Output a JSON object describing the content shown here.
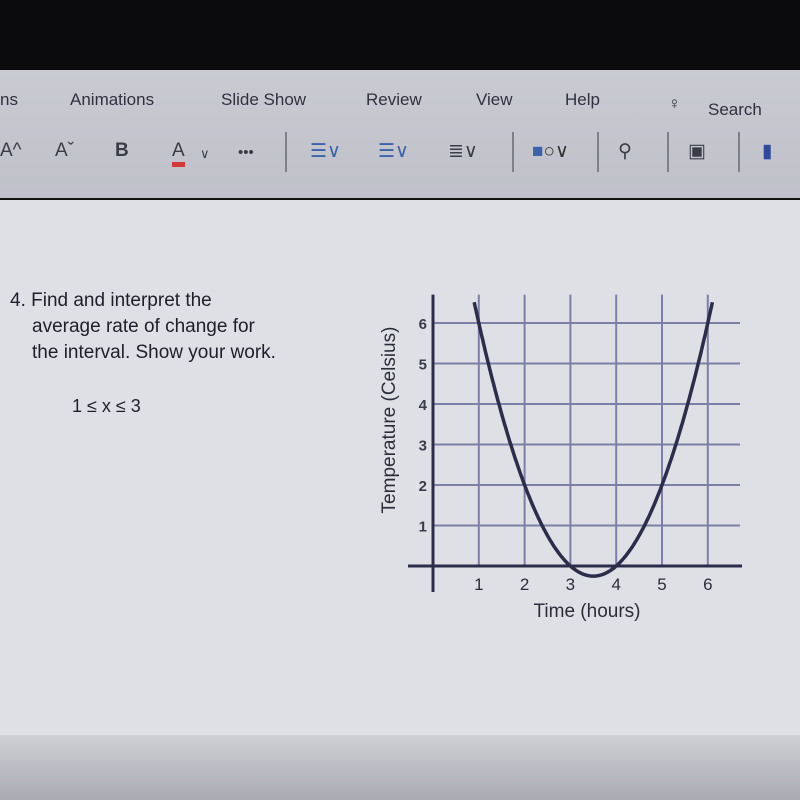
{
  "ribbon": {
    "tabs": [
      "ns",
      "Animations",
      "Slide Show",
      "Review",
      "View",
      "Help"
    ],
    "search_label": "Search",
    "tools": {
      "grow_font": "A^",
      "shrink_font": "Aˇ",
      "bold": "B",
      "font_color": "A",
      "more": "•••"
    }
  },
  "question": {
    "line1": "4. Find and interpret the",
    "line2": "average rate of change for",
    "line3": "the interval. Show your work.",
    "interval": "1 ≤ x ≤ 3"
  },
  "colors": {
    "curve": "#2b2d4a",
    "grid": "#7c80a8",
    "axis": "#2b2d4a",
    "font_color_bar": "#d23a3a"
  },
  "chart_data": {
    "type": "line",
    "xlabel": "Time (hours)",
    "ylabel": "Temperature (Celsius)",
    "xticks": [
      "1",
      "2",
      "3",
      "4",
      "5",
      "6"
    ],
    "yticks": [
      "1",
      "2",
      "3",
      "4",
      "5",
      "6"
    ],
    "xlim": [
      0,
      6.7
    ],
    "ylim": [
      -0.6,
      6.7
    ],
    "grid": true,
    "series": [
      {
        "x": [
          0.9,
          1,
          1.5,
          2,
          2.5,
          3,
          3.5,
          4,
          4.5,
          5,
          5.5,
          6,
          6.1
        ],
        "y": [
          6.51,
          6,
          3.75,
          2,
          0.75,
          0,
          -0.25,
          0,
          0.75,
          2,
          3.75,
          6,
          6.51
        ]
      }
    ]
  }
}
